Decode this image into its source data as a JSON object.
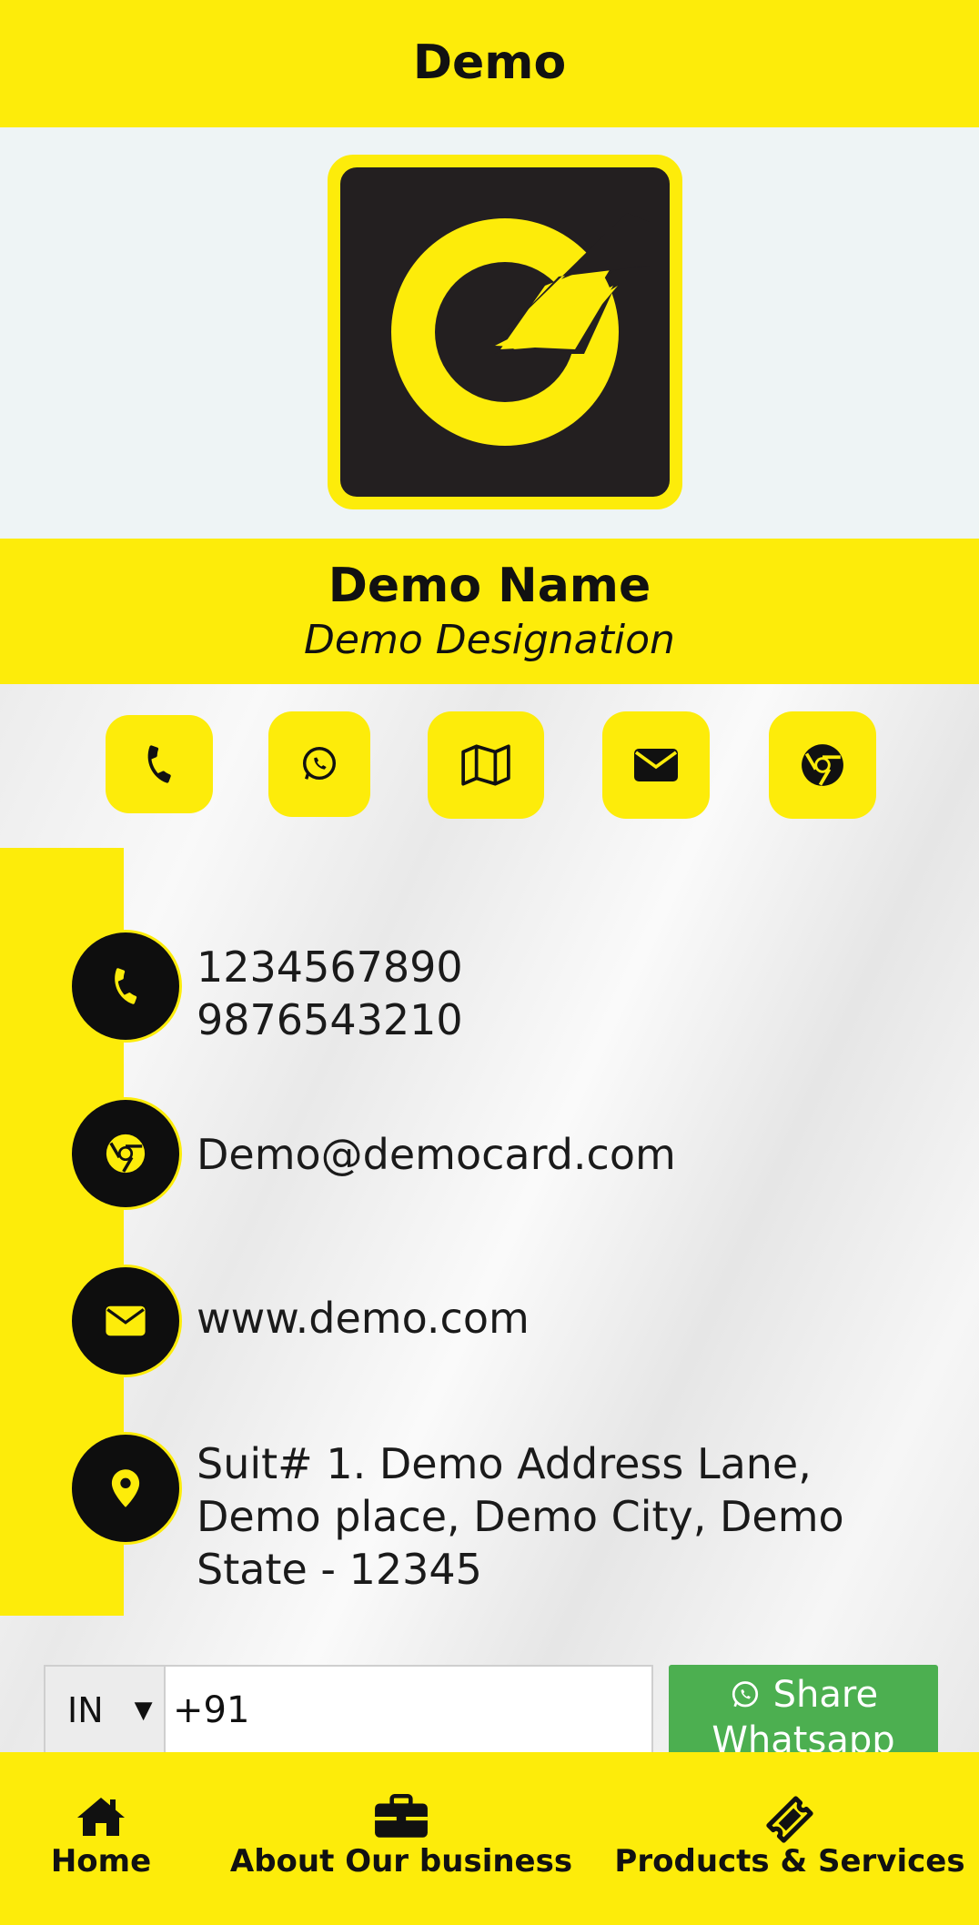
{
  "header": {
    "title": "Demo"
  },
  "profile": {
    "name": "Demo Name",
    "designation": "Demo Designation"
  },
  "quick_actions": [
    {
      "name": "call",
      "icon": "phone-icon"
    },
    {
      "name": "whatsapp",
      "icon": "whatsapp-icon"
    },
    {
      "name": "map",
      "icon": "map-icon"
    },
    {
      "name": "email",
      "icon": "envelope-icon"
    },
    {
      "name": "website",
      "icon": "chrome-icon"
    }
  ],
  "contacts": {
    "phones": {
      "icon": "phone-icon",
      "line1": "1234567890",
      "line2": "9876543210"
    },
    "email": {
      "icon": "chrome-icon",
      "text": "Demo@democard.com"
    },
    "website": {
      "icon": "envelope-icon",
      "text": "www.demo.com"
    },
    "address": {
      "icon": "location-pin-icon",
      "line1": "Suit# 1. Demo Address Lane,",
      "line2": "Demo place, Demo City, Demo",
      "line3": "State - 12345"
    }
  },
  "share": {
    "country_code": "IN",
    "phone_value": "+91",
    "button_label": "Share Whatsapp",
    "button_color": "#4caf50"
  },
  "bottom_nav": [
    {
      "label": "Home",
      "icon": "home-icon"
    },
    {
      "label": "About Our business",
      "icon": "briefcase-icon"
    },
    {
      "label": "Products & Services",
      "icon": "ticket-icon"
    }
  ],
  "colors": {
    "accent": "#fdec0a",
    "dark": "#231f20"
  }
}
